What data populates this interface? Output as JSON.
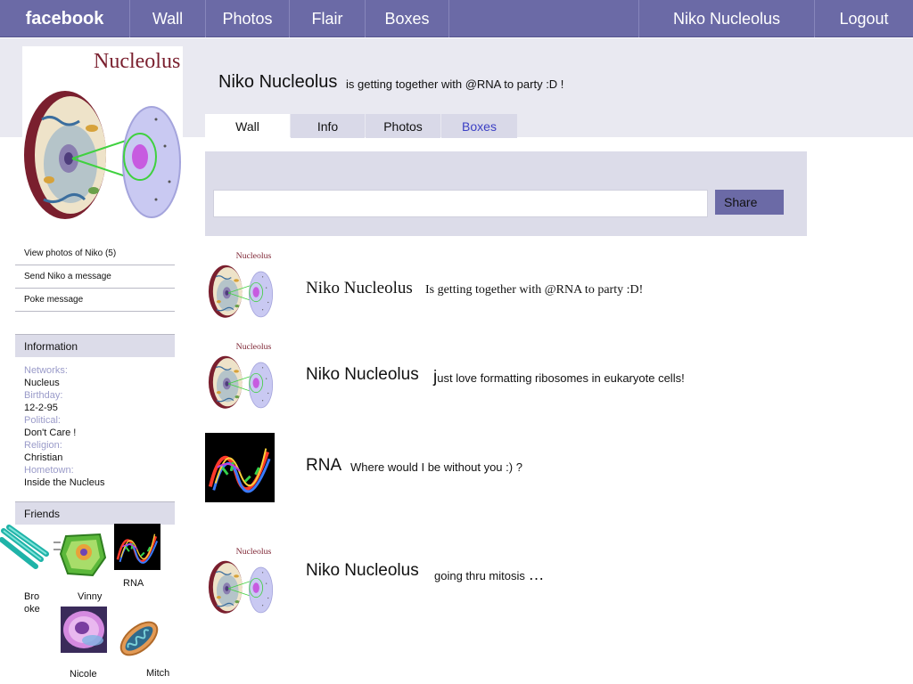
{
  "topnav": {
    "brand": "facebook",
    "items": [
      "Wall",
      "Photos",
      "Flair",
      "Boxes"
    ],
    "user": "Niko Nucleolus",
    "logout": "Logout"
  },
  "profile": {
    "picture_caption": "Nucleolus",
    "name": "Niko Nucleolus",
    "status": "is getting together with @RNA to party :D !"
  },
  "tabs": [
    "Wall",
    "Info",
    "Photos",
    "Boxes"
  ],
  "share": {
    "input_value": "",
    "button": "Share"
  },
  "side_links": [
    "View photos of Niko (5)",
    "Send Niko a message",
    "Poke message"
  ],
  "information": {
    "heading": "Information",
    "fields": [
      {
        "label": "Networks:",
        "value": "Nucleus"
      },
      {
        "label": "Birthday:",
        "value": "12-2-95"
      },
      {
        "label": "Political:",
        "value": "Don't Care !"
      },
      {
        "label": "Religion:",
        "value": "Christian"
      },
      {
        "label": "Hometown:",
        "value": "Inside the Nucleus"
      }
    ]
  },
  "friends": {
    "heading": "Friends",
    "list": [
      {
        "name_line1": "Bro",
        "name_line2": "oke"
      },
      {
        "name": "Vinny"
      },
      {
        "name": "RNA"
      },
      {
        "name": "Nicole"
      },
      {
        "name": "Mitch"
      }
    ]
  },
  "posts": [
    {
      "name": "Niko Nucleolus",
      "text": "Is getting together with @RNA to party :D!",
      "thumb_caption": "Nucleolus"
    },
    {
      "name": "Niko Nucleolus",
      "text_initial": "j",
      "text": "ust love formatting ribosomes in eukaryote cells!",
      "thumb_caption": "Nucleolus"
    },
    {
      "name": "RNA",
      "text": "Where would I be without you :) ?"
    },
    {
      "name": "Niko Nucleolus",
      "text": "going thru mitosis",
      "text_tail": "…",
      "thumb_caption": "Nucleolus"
    }
  ],
  "colors": {
    "topbar": "#6b6aa6",
    "band": "#e9e9f1",
    "tab_inactive": "#d9d9e8",
    "label": "#9a9bc9",
    "link_blue": "#3b3fc4"
  }
}
